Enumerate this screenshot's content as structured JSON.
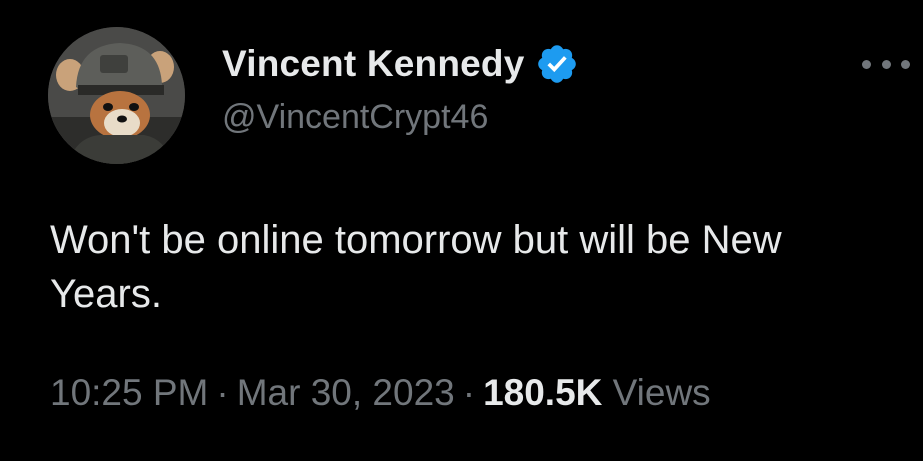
{
  "author": {
    "display_name": "Vincent Kennedy",
    "handle": "@VincentCrypt46",
    "verified_icon": "verified-badge-icon",
    "verified_color": "#1d9bf0"
  },
  "tweet": {
    "text": "Won't be online tomorrow but will be New Years."
  },
  "meta": {
    "time": "10:25 PM",
    "separator": "·",
    "date": "Mar 30, 2023",
    "views_count": "180.5K",
    "views_label": "Views"
  },
  "actions": {
    "more_icon": "more-options-icon"
  },
  "colors": {
    "background": "#000000",
    "primary_text": "#e7e9ea",
    "secondary_text": "#71767b"
  }
}
